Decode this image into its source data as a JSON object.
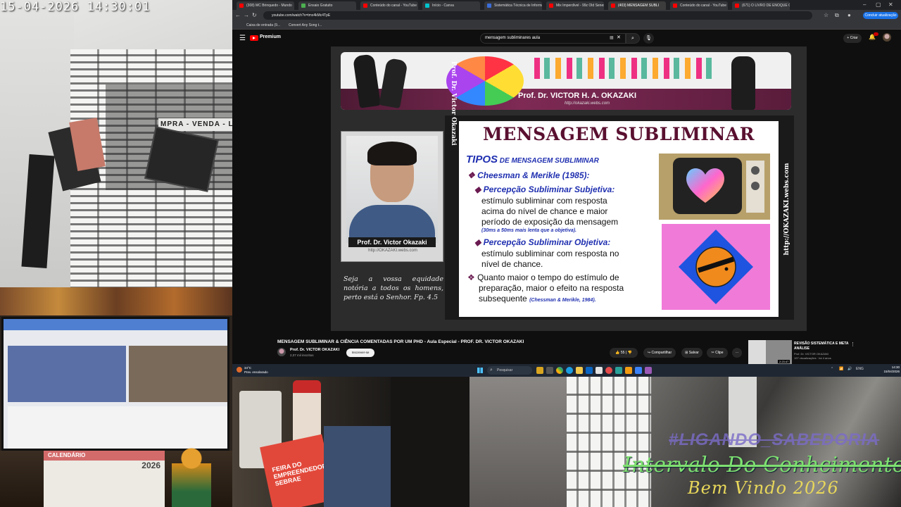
{
  "camera": {
    "timestamp": "15-04-2026  14:30:01",
    "sign_text": "MPRA - VENDA - LOT",
    "calendar_label": "CALENDÁRIO",
    "calendar_year": "2026",
    "card_text": "FEIRA DO EMPREENDEDOR SEBRAE",
    "overlay_line1": "#LIGANDO_SABEDORIA",
    "overlay_line2": "Intervalo Do Conhcimento",
    "overlay_line3": "Bem Vindo 2026"
  },
  "browser": {
    "tabs": [
      {
        "label": "(308) MC Brinquedo - Mundo",
        "color": "#ff0000",
        "active": false
      },
      {
        "label": "Ensaio Gratuito",
        "color": "#4caf50",
        "active": false
      },
      {
        "label": "Conteúdo do canal - YouTube",
        "color": "#ff0000",
        "active": false
      },
      {
        "label": "Início - Canva",
        "color": "#00c4cc",
        "active": false
      },
      {
        "label": "Sistemática Técnica de Informaci",
        "color": "#3b6dd8",
        "active": false
      },
      {
        "label": "Mix Imperdível - 99z Old Senes",
        "color": "#ff0000",
        "active": false
      },
      {
        "label": "(403) MENSAGEM SUBLI",
        "color": "#ff0000",
        "active": true
      },
      {
        "label": "Conteúdo do canal - YouTube",
        "color": "#ff0000",
        "active": false
      },
      {
        "label": "(671) O LIVRO DE ENOQUE O",
        "color": "#ff0000",
        "active": false
      }
    ],
    "url": "youtube.com/watch?v=tmx4kMc4TpE",
    "update_button": "Concluir atualização",
    "bookmarks": [
      "Caixa de entrada (9...",
      "Convert Any Song t..."
    ]
  },
  "youtube": {
    "brand": "Premium",
    "search_value": "mensagem subliminares aula",
    "create_label": "Criar",
    "video_title": "MENSAGEM SUBLIMINAR & CIÊNCIA COMENTADAS POR UM PHD - Aula Especial - PROF. DR. VICTOR OKAZAKI",
    "channel_name": "Prof. Dr. VICTOR OKAZAKI",
    "channel_subs": "2,07 mil inscritos",
    "subscribe_label": "Inscrever-se",
    "like_count": "55",
    "share_label": "Compartilhar",
    "save_label": "Salvar",
    "clip_label": "Clipe",
    "recommended": {
      "title": "REVISÃO SISTEMÁTICA E META ANÁLISE",
      "channel": "Prof. Dr. VICTOR OKAZAKI",
      "meta": "197 visualizações · há 4 anos",
      "duration": "2:23:47"
    }
  },
  "slide": {
    "banner_title": "Prof. Dr. VICTOR H. A. OKAZAKI",
    "banner_url": "http://okazaki.webs.com",
    "side_left": "Prof. Dr. Victor Okazaki",
    "side_right": "http://OKAZAKI.webs.com",
    "photo_label": "Prof. Dr. Victor Okazaki",
    "photo_url": "http://OKAZAKI.webs.com",
    "quote": "Seja a vossa equidade notória a todos os homens, perto está o Senhor. Fp. 4.5",
    "title": "MENSAGEM SUBLIMINAR",
    "tipos_big": "TIPOS",
    "tipos_small": " DE MENSAGEM SUBLIMINAR",
    "cheesman": "Cheesman & Merikle (1985):",
    "subj_heading": "Percepção Subliminar Subjetiva:",
    "subj_line1": "estímulo subliminar com resposta",
    "subj_line2": "acima do nível de chance e maior",
    "subj_line3": "período de exposição da mensagem",
    "subj_note": "(30ms a 50ms mais lenta que a objetiva).",
    "obj_heading": "Percepção Subliminar Objetiva:",
    "obj_line1": "estímulo subliminar com resposta no",
    "obj_line2": "nível de chance.",
    "q_line1": "Quanto maior o tempo do estímulo de",
    "q_line2": "preparação, maior o efeito na resposta",
    "q_line3": "subsequente",
    "q_cite": "(Chessman & Merikle, 1984)."
  },
  "taskbar": {
    "weather_temp": "34°C",
    "weather_text": "Prev. ensolarado",
    "search_placeholder": "Pesquisar",
    "lang": "ENG",
    "time": "14:30",
    "date": "15/04/2026"
  }
}
